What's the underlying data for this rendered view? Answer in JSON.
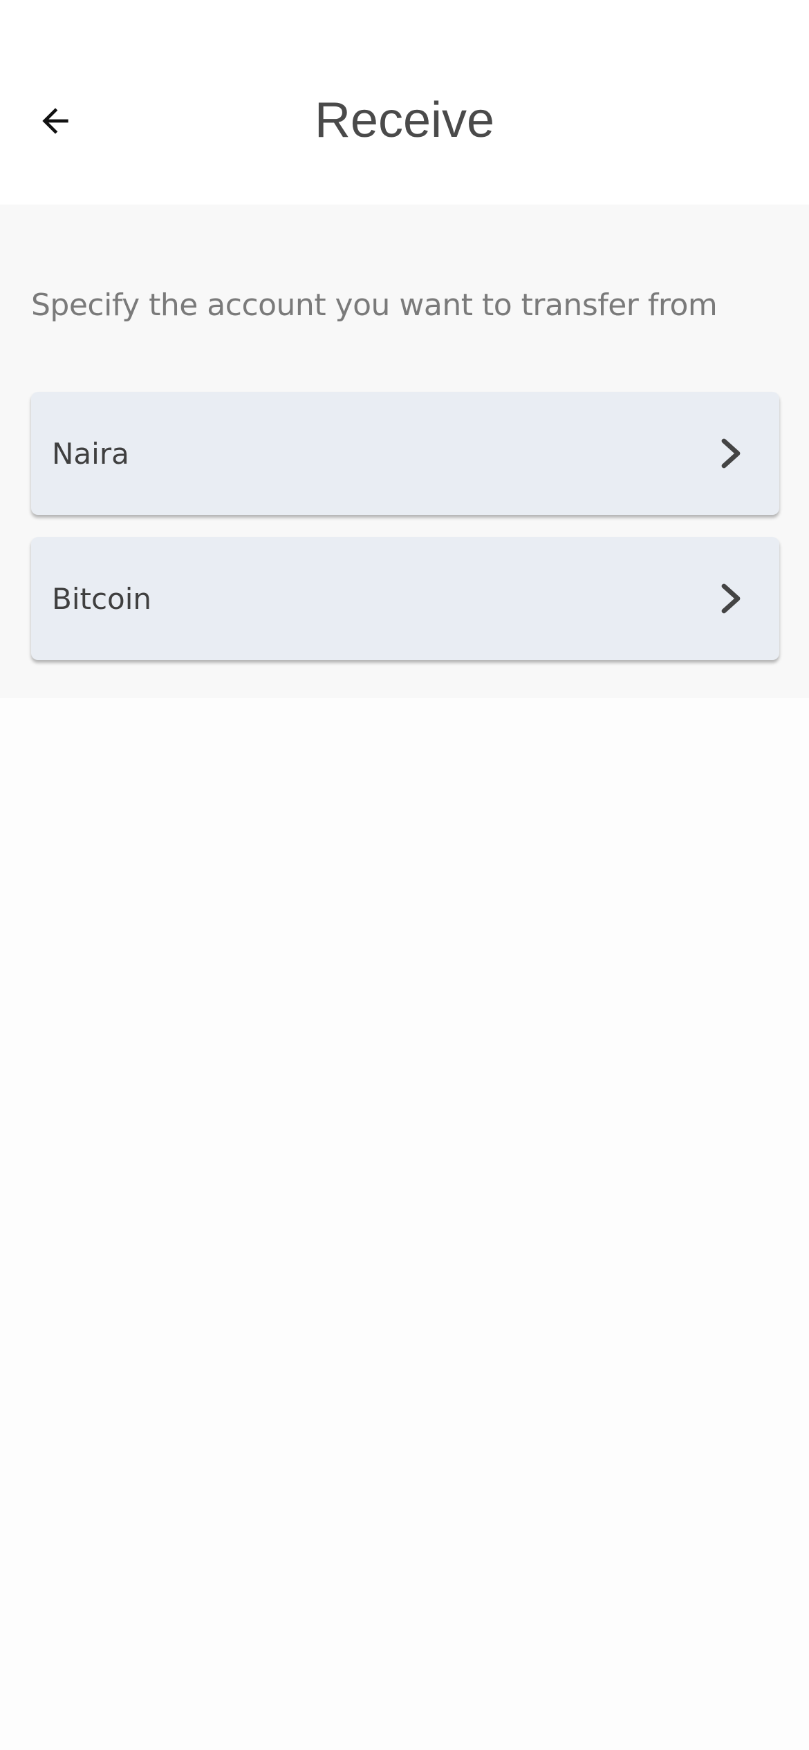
{
  "header": {
    "title": "Receive",
    "back_icon": "arrow-left-icon"
  },
  "main": {
    "instruction": "Specify the account you want to transfer from",
    "accounts": [
      {
        "label": "Naira",
        "icon": "chevron-right-icon"
      },
      {
        "label": "Bitcoin",
        "icon": "chevron-right-icon"
      }
    ]
  },
  "colors": {
    "card_background": "#e9edf3",
    "content_background": "#f8f8f8",
    "title_text": "#4a4a4a",
    "instruction_text": "#7a7a7a"
  }
}
